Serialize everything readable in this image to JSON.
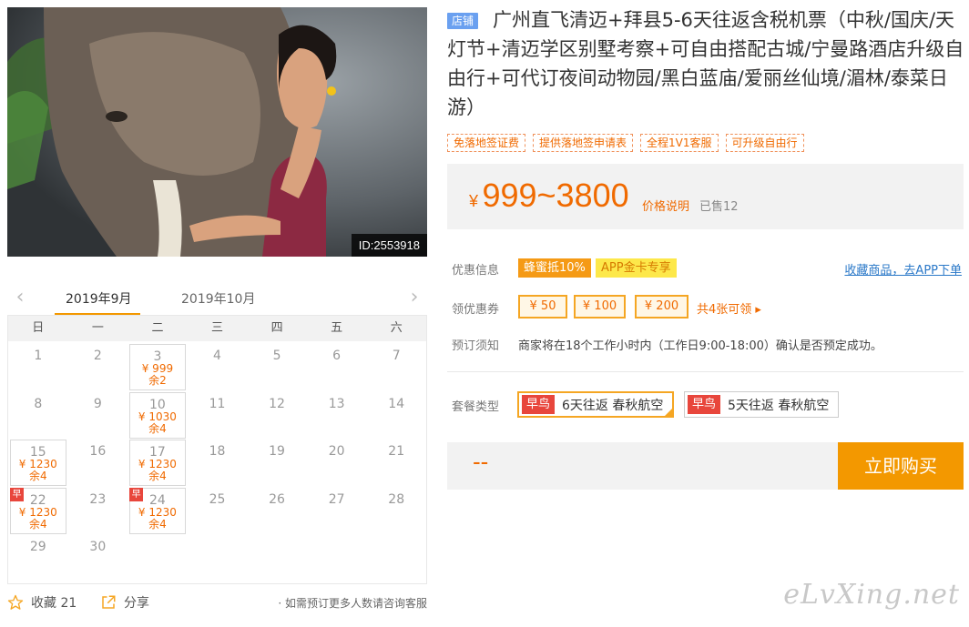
{
  "hero": {
    "id_badge": "ID:2553918"
  },
  "calendar": {
    "months": [
      "2019年9月",
      "2019年10月"
    ],
    "weekdays": [
      "日",
      "一",
      "二",
      "三",
      "四",
      "五",
      "六"
    ],
    "days": [
      {
        "d": "1"
      },
      {
        "d": "2"
      },
      {
        "d": "3",
        "price": "¥ 999",
        "remain": "余2"
      },
      {
        "d": "4"
      },
      {
        "d": "5"
      },
      {
        "d": "6"
      },
      {
        "d": "7"
      },
      {
        "d": "8"
      },
      {
        "d": "9"
      },
      {
        "d": "10",
        "price": "¥ 1030",
        "remain": "余4"
      },
      {
        "d": "11"
      },
      {
        "d": "12"
      },
      {
        "d": "13"
      },
      {
        "d": "14"
      },
      {
        "d": "15",
        "price": "¥ 1230",
        "remain": "余4"
      },
      {
        "d": "16"
      },
      {
        "d": "17",
        "price": "¥ 1230",
        "remain": "余4"
      },
      {
        "d": "18"
      },
      {
        "d": "19"
      },
      {
        "d": "20"
      },
      {
        "d": "21"
      },
      {
        "d": "22",
        "price": "¥ 1230",
        "remain": "余4",
        "early": "早"
      },
      {
        "d": "23"
      },
      {
        "d": "24",
        "price": "¥ 1230",
        "remain": "余4",
        "early": "早"
      },
      {
        "d": "25"
      },
      {
        "d": "26"
      },
      {
        "d": "27"
      },
      {
        "d": "28"
      },
      {
        "d": "29"
      },
      {
        "d": "30"
      }
    ]
  },
  "footer": {
    "fav_label": "收藏 21",
    "share_label": "分享",
    "consult": "· 如需预订更多人数请咨询客服"
  },
  "product": {
    "shop_tag": "店铺",
    "title": "广州直飞清迈+拜县5-6天往返含税机票（中秋/国庆/天灯节+清迈学区别墅考察+可自由搭配古城/宁曼路酒店升级自由行+可代订夜间动物园/黑白蓝庙/爱丽丝仙境/湄林/泰菜日游）",
    "tags": [
      "免落地签证费",
      "提供落地签申请表",
      "全程1V1客服",
      "可升级自由行"
    ],
    "price_currency": "¥",
    "price_range": "999~3800",
    "price_note": "价格说明",
    "sold": "已售12"
  },
  "offers": {
    "label": "优惠信息",
    "promo1": "蜂蜜抵10%",
    "promo2": "APP金卡专享",
    "fav_app": "收藏商品，去APP下单"
  },
  "coupons": {
    "label": "领优惠券",
    "items": [
      "¥ 50",
      "¥ 100",
      "¥ 200"
    ],
    "more": "共4张可领 ▸"
  },
  "notice": {
    "label": "预订须知",
    "text": "商家将在18个工作小时内（工作日9:00-18:00）确认是否预定成功。"
  },
  "packages": {
    "label": "套餐类型",
    "items": [
      {
        "badge": "早鸟",
        "name": "6天往返 春秋航空"
      },
      {
        "badge": "早鸟",
        "name": "5天往返 春秋航空"
      }
    ]
  },
  "buy": {
    "qty": "--",
    "button": "立即购买"
  },
  "watermark": "eLvXing.net"
}
